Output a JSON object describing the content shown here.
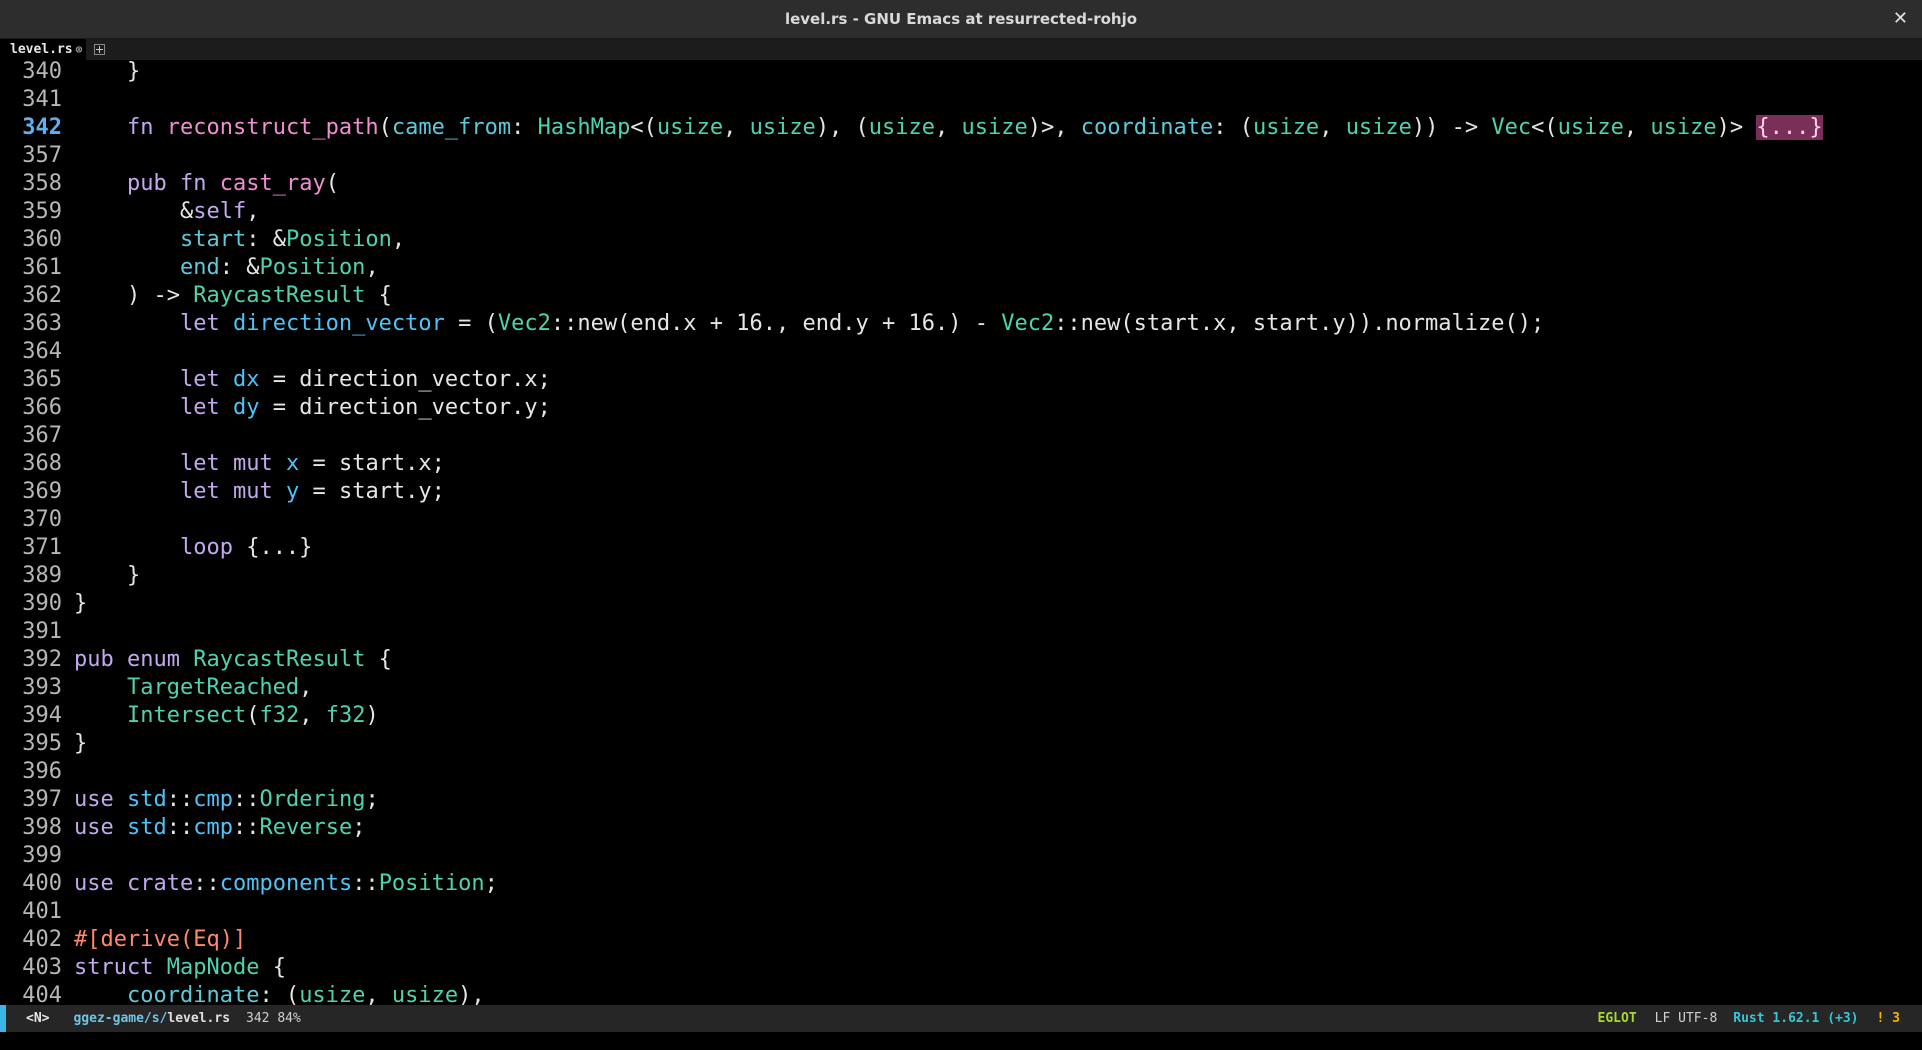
{
  "window": {
    "title": "level.rs - GNU Emacs at resurrected-rohjo",
    "close_glyph": "✕"
  },
  "tabs": [
    {
      "label": "level.rs",
      "close_glyph": "⊗"
    }
  ],
  "editor": {
    "current_line": "342",
    "lines": [
      {
        "n": "340",
        "tokens": [
          [
            "",
            "    }"
          ]
        ]
      },
      {
        "n": "341",
        "tokens": []
      },
      {
        "n": "342",
        "tokens": [
          [
            "",
            "    "
          ],
          [
            "kw",
            "fn"
          ],
          [
            "",
            " "
          ],
          [
            "fn",
            "reconstruct_path"
          ],
          [
            "",
            "("
          ],
          [
            "pa",
            "came_from"
          ],
          [
            "",
            ": "
          ],
          [
            "ty",
            "HashMap"
          ],
          [
            "",
            "<("
          ],
          [
            "ty",
            "usize"
          ],
          [
            "",
            ", "
          ],
          [
            "ty",
            "usize"
          ],
          [
            "",
            "), ("
          ],
          [
            "ty",
            "usize"
          ],
          [
            "",
            ", "
          ],
          [
            "ty",
            "usize"
          ],
          [
            "",
            ")>, "
          ],
          [
            "pa",
            "coordinate"
          ],
          [
            "",
            ": ("
          ],
          [
            "ty",
            "usize"
          ],
          [
            "",
            ", "
          ],
          [
            "ty",
            "usize"
          ],
          [
            "",
            ")) -> "
          ],
          [
            "ty",
            "Vec"
          ],
          [
            "",
            "<("
          ],
          [
            "ty",
            "usize"
          ],
          [
            "",
            ", "
          ],
          [
            "ty",
            "usize"
          ],
          [
            "",
            ")> "
          ],
          [
            "fold-hl",
            "{...}"
          ]
        ]
      },
      {
        "n": "357",
        "tokens": []
      },
      {
        "n": "358",
        "tokens": [
          [
            "",
            "    "
          ],
          [
            "kw",
            "pub"
          ],
          [
            "",
            " "
          ],
          [
            "kw",
            "fn"
          ],
          [
            "",
            " "
          ],
          [
            "fn",
            "cast_ray"
          ],
          [
            "",
            "("
          ]
        ]
      },
      {
        "n": "359",
        "tokens": [
          [
            "",
            "        &"
          ],
          [
            "kw",
            "self"
          ],
          [
            "",
            ","
          ]
        ]
      },
      {
        "n": "360",
        "tokens": [
          [
            "",
            "        "
          ],
          [
            "pa",
            "start"
          ],
          [
            "",
            ": &"
          ],
          [
            "ty",
            "Position"
          ],
          [
            "",
            ","
          ]
        ]
      },
      {
        "n": "361",
        "tokens": [
          [
            "",
            "        "
          ],
          [
            "pa",
            "end"
          ],
          [
            "",
            ": &"
          ],
          [
            "ty",
            "Position"
          ],
          [
            "",
            ","
          ]
        ]
      },
      {
        "n": "362",
        "tokens": [
          [
            "",
            "    ) -> "
          ],
          [
            "ty",
            "RaycastResult"
          ],
          [
            "",
            " {"
          ]
        ]
      },
      {
        "n": "363",
        "tokens": [
          [
            "",
            "        "
          ],
          [
            "kw",
            "let"
          ],
          [
            "",
            " "
          ],
          [
            "nm",
            "direction_vector"
          ],
          [
            "",
            " = ("
          ],
          [
            "ty",
            "Vec2"
          ],
          [
            "",
            "::new(end.x + 16., end.y + 16.) - "
          ],
          [
            "ty",
            "Vec2"
          ],
          [
            "",
            "::new(start.x, start.y)).normalize();"
          ]
        ]
      },
      {
        "n": "364",
        "tokens": []
      },
      {
        "n": "365",
        "tokens": [
          [
            "",
            "        "
          ],
          [
            "kw",
            "let"
          ],
          [
            "",
            " "
          ],
          [
            "nm",
            "dx"
          ],
          [
            "",
            " = direction_vector.x;"
          ]
        ]
      },
      {
        "n": "366",
        "tokens": [
          [
            "",
            "        "
          ],
          [
            "kw",
            "let"
          ],
          [
            "",
            " "
          ],
          [
            "nm",
            "dy"
          ],
          [
            "",
            " = direction_vector.y;"
          ]
        ]
      },
      {
        "n": "367",
        "tokens": []
      },
      {
        "n": "368",
        "tokens": [
          [
            "",
            "        "
          ],
          [
            "kw",
            "let"
          ],
          [
            "",
            " "
          ],
          [
            "kw",
            "mut"
          ],
          [
            "",
            " "
          ],
          [
            "nm",
            "x"
          ],
          [
            "",
            " = start.x;"
          ]
        ]
      },
      {
        "n": "369",
        "tokens": [
          [
            "",
            "        "
          ],
          [
            "kw",
            "let"
          ],
          [
            "",
            " "
          ],
          [
            "kw",
            "mut"
          ],
          [
            "",
            " "
          ],
          [
            "nm",
            "y"
          ],
          [
            "",
            " = start.y;"
          ]
        ]
      },
      {
        "n": "370",
        "tokens": []
      },
      {
        "n": "371",
        "tokens": [
          [
            "",
            "        "
          ],
          [
            "kw",
            "loop"
          ],
          [
            "",
            " {...}"
          ]
        ]
      },
      {
        "n": "389",
        "tokens": [
          [
            "",
            "    }"
          ]
        ]
      },
      {
        "n": "390",
        "tokens": [
          [
            "",
            "}"
          ]
        ]
      },
      {
        "n": "391",
        "tokens": []
      },
      {
        "n": "392",
        "tokens": [
          [
            "kw",
            "pub"
          ],
          [
            "",
            " "
          ],
          [
            "kw",
            "enum"
          ],
          [
            "",
            " "
          ],
          [
            "ty",
            "RaycastResult"
          ],
          [
            "",
            " {"
          ]
        ]
      },
      {
        "n": "393",
        "tokens": [
          [
            "",
            "    "
          ],
          [
            "ty",
            "TargetReached"
          ],
          [
            "",
            ","
          ]
        ]
      },
      {
        "n": "394",
        "tokens": [
          [
            "",
            "    "
          ],
          [
            "ty",
            "Intersect"
          ],
          [
            "",
            "("
          ],
          [
            "ty",
            "f32"
          ],
          [
            "",
            ", "
          ],
          [
            "ty",
            "f32"
          ],
          [
            "",
            ")"
          ]
        ]
      },
      {
        "n": "395",
        "tokens": [
          [
            "",
            "}"
          ]
        ]
      },
      {
        "n": "396",
        "tokens": []
      },
      {
        "n": "397",
        "tokens": [
          [
            "kw",
            "use"
          ],
          [
            "",
            " "
          ],
          [
            "nm",
            "std"
          ],
          [
            "",
            "::"
          ],
          [
            "nm",
            "cmp"
          ],
          [
            "",
            "::"
          ],
          [
            "ty",
            "Ordering"
          ],
          [
            "",
            ";"
          ]
        ]
      },
      {
        "n": "398",
        "tokens": [
          [
            "kw",
            "use"
          ],
          [
            "",
            " "
          ],
          [
            "nm",
            "std"
          ],
          [
            "",
            "::"
          ],
          [
            "nm",
            "cmp"
          ],
          [
            "",
            "::"
          ],
          [
            "ty",
            "Reverse"
          ],
          [
            "",
            ";"
          ]
        ]
      },
      {
        "n": "399",
        "tokens": []
      },
      {
        "n": "400",
        "tokens": [
          [
            "kw",
            "use"
          ],
          [
            "",
            " "
          ],
          [
            "kw",
            "crate"
          ],
          [
            "",
            "::"
          ],
          [
            "nm",
            "components"
          ],
          [
            "",
            "::"
          ],
          [
            "ty",
            "Position"
          ],
          [
            "",
            ";"
          ]
        ]
      },
      {
        "n": "401",
        "tokens": []
      },
      {
        "n": "402",
        "tokens": [
          [
            "at",
            "#[derive(Eq)]"
          ]
        ]
      },
      {
        "n": "403",
        "tokens": [
          [
            "kw",
            "struct"
          ],
          [
            "",
            " "
          ],
          [
            "ty",
            "MapNode"
          ],
          [
            "",
            " {"
          ]
        ]
      },
      {
        "n": "404",
        "tokens": [
          [
            "",
            "    "
          ],
          [
            "pa",
            "coordinate"
          ],
          [
            "",
            ": ("
          ],
          [
            "ty",
            "usize"
          ],
          [
            "",
            ", "
          ],
          [
            "ty",
            "usize"
          ],
          [
            "",
            "),"
          ]
        ]
      }
    ]
  },
  "modeline": {
    "state": "<N>",
    "path_dir": "ggez-game/s/",
    "path_file": "level.rs",
    "position": "342 84%",
    "eglot": "EGLOT",
    "encoding": "LF UTF-8",
    "language": "Rust 1.62.1 (+3)",
    "warnings": "! 3"
  },
  "colors": {
    "keyword": "#c3a8f0",
    "function": "#f08ecf",
    "type": "#4fd2b0",
    "accent": "#3ab7e8",
    "warning": "#f5b400",
    "eglot": "#a6d92b"
  }
}
